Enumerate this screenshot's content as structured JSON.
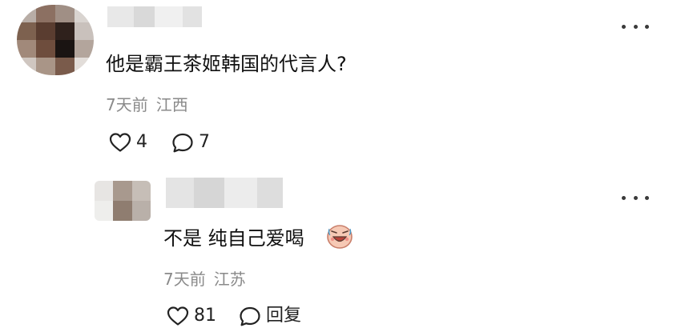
{
  "comments": [
    {
      "text": "他是霸王茶姬韩国的代言人?",
      "time": "7天前",
      "location": "江西",
      "likes": "4",
      "replies": "7",
      "avatar": "pixelated-avatar",
      "username": "blurred-username"
    }
  ],
  "reply": {
    "text": "不是 纯自己爱喝",
    "emoji": "laughing-crying-emoji",
    "time": "7天前",
    "location": "江苏",
    "likes": "81",
    "reply_label": "回复",
    "avatar": "pixelated-avatar",
    "username": "blurred-username"
  },
  "icons": {
    "more": "more-horizontal-icon",
    "like": "heart-outline-icon",
    "comment": "comment-bubble-icon"
  },
  "colors": {
    "text": "#111111",
    "meta": "#8a8a8a",
    "icon": "#222222",
    "background": "#ffffff"
  }
}
